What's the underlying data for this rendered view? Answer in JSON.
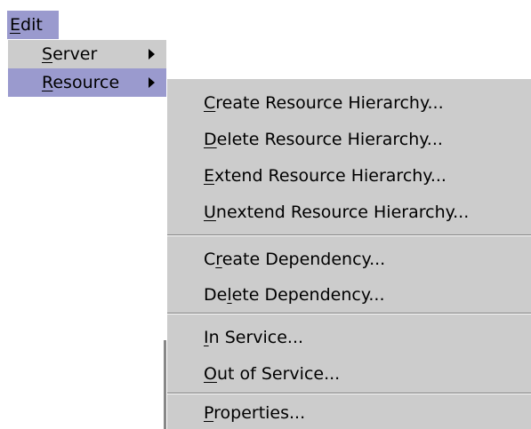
{
  "menubar": {
    "edit": "Edit",
    "edit_mnemonic_rest": "dit",
    "edit_mnemonic": "E"
  },
  "edit_menu": {
    "items": [
      {
        "mn": "S",
        "rest": "erver",
        "has_submenu": true
      },
      {
        "mn": "R",
        "rest": "esource",
        "has_submenu": true,
        "selected": true
      }
    ]
  },
  "resource_menu": {
    "items": [
      {
        "pre": "",
        "mn": "C",
        "rest": "reate Resource Hierarchy..."
      },
      {
        "pre": "",
        "mn": "D",
        "rest": "elete Resource Hierarchy..."
      },
      {
        "pre": "",
        "mn": "E",
        "rest": "xtend Resource Hierarchy..."
      },
      {
        "pre": "",
        "mn": "U",
        "rest": "nextend Resource Hierarchy..."
      },
      {
        "pre": "C",
        "mn": "r",
        "rest": "eate Dependency..."
      },
      {
        "pre": "De",
        "mn": "l",
        "rest": "ete Dependency..."
      },
      {
        "pre": "",
        "mn": "I",
        "rest": "n Service..."
      },
      {
        "pre": "",
        "mn": "O",
        "rest": "ut of Service..."
      },
      {
        "pre": "",
        "mn": "P",
        "rest": "roperties..."
      }
    ]
  },
  "colors": {
    "menu_bg": "#cccccc",
    "selection": "#9a9ace",
    "separator": "#808080"
  }
}
